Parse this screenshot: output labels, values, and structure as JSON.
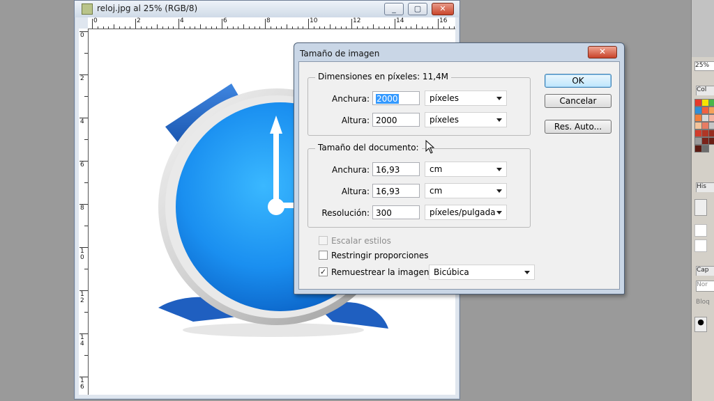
{
  "document": {
    "title": "reloj.jpg al 25% (RGB/8)",
    "buttons": {
      "minimize": "_",
      "maximize": "▢",
      "close": "✕"
    },
    "ruler_top_labels": [
      "0",
      "2",
      "4",
      "6",
      "8",
      "10",
      "12",
      "14",
      "16"
    ],
    "ruler_left_labels": [
      "0",
      "2",
      "4",
      "6",
      "8",
      "1\n0",
      "1\n2",
      "1\n4",
      "1\n6"
    ]
  },
  "dialog": {
    "title": "Tamaño de imagen",
    "close": "✕",
    "pixel_dims": {
      "label": "Dimensiones en píxeles: 11,4M",
      "width_label": "Anchura:",
      "width_value": "2000",
      "width_unit": "píxeles",
      "height_label": "Altura:",
      "height_value": "2000",
      "height_unit": "píxeles"
    },
    "doc_size": {
      "label": "Tamaño del documento:",
      "width_label": "Anchura:",
      "width_value": "16,93",
      "width_unit": "cm",
      "height_label": "Altura:",
      "height_value": "16,93",
      "height_unit": "cm",
      "res_label": "Resolución:",
      "res_value": "300",
      "res_unit": "píxeles/pulgada"
    },
    "options": {
      "scale_styles": "Escalar estilos",
      "constrain": "Restringir proporciones",
      "resample": "Remuestrear la imagen:",
      "resample_method": "Bicúbica",
      "checkmark": "✓"
    },
    "buttons": {
      "ok": "OK",
      "cancel": "Cancelar",
      "auto": "Res. Auto..."
    }
  },
  "panel": {
    "zoom": "25%",
    "color_tab": "Col",
    "history_tab": "His",
    "layers_tab": "Cap",
    "blend_mode": "Nor",
    "lock": "Bloq"
  },
  "colors": {
    "clock_blue": "#1e8ff0",
    "dialog_border": "#4f6178",
    "selection": "#3399ff"
  }
}
